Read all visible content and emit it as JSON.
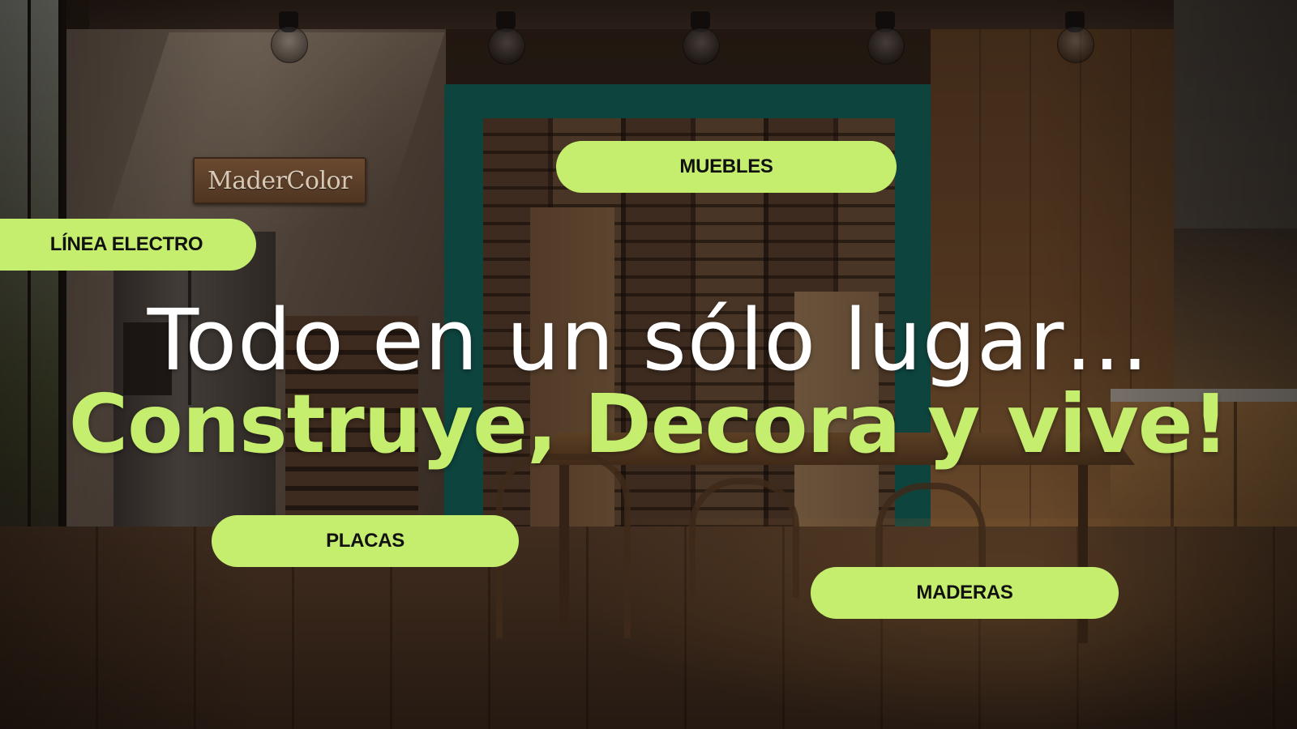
{
  "logo": {
    "text": "MaderColor"
  },
  "categories": {
    "muebles": "MUEBLES",
    "linea_electro": "LÍNEA ELECTRO",
    "placas": "PLACAS",
    "maderas": "MADERAS"
  },
  "hero": {
    "headline": "Todo en un sólo lugar…",
    "tagline": "Construye, Decora y vive!"
  },
  "colors": {
    "accent": "#c6ee6e",
    "headline": "#ffffff",
    "pill_text": "#111111",
    "alcove": "#0e6a62"
  }
}
